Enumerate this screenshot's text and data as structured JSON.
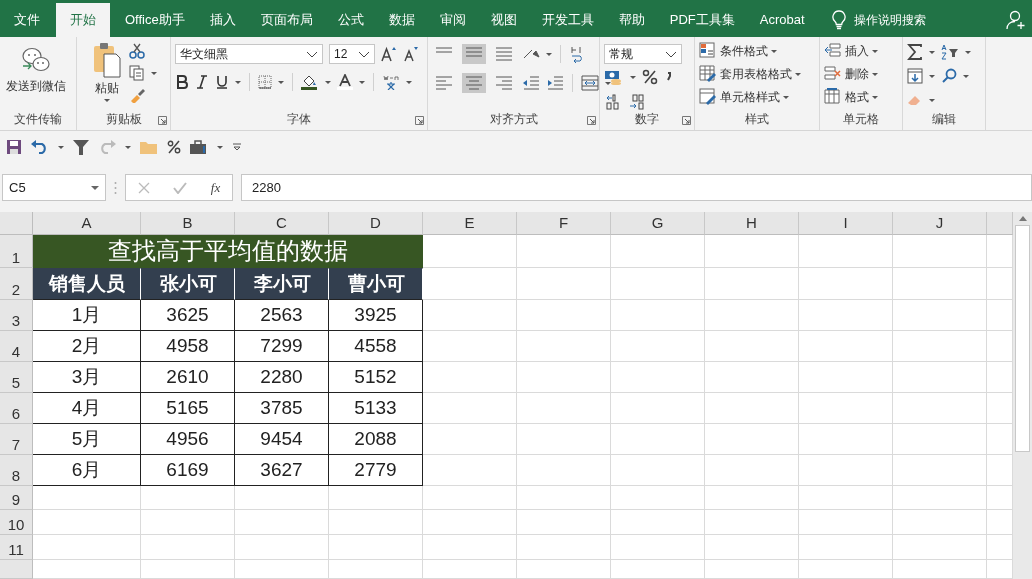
{
  "tabs": [
    {
      "label": "文件",
      "selected": false
    },
    {
      "label": "开始",
      "selected": true
    },
    {
      "label": "Office助手",
      "selected": false
    },
    {
      "label": "插入",
      "selected": false
    },
    {
      "label": "页面布局",
      "selected": false
    },
    {
      "label": "公式",
      "selected": false
    },
    {
      "label": "数据",
      "selected": false
    },
    {
      "label": "审阅",
      "selected": false
    },
    {
      "label": "视图",
      "selected": false
    },
    {
      "label": "开发工具",
      "selected": false
    },
    {
      "label": "帮助",
      "selected": false
    },
    {
      "label": "PDF工具集",
      "selected": false
    },
    {
      "label": "Acrobat",
      "selected": false
    }
  ],
  "tell_me": "操作说明搜索",
  "ribbon_groups": [
    {
      "kind": "wechat",
      "label": "文件传输",
      "button": "发送到微信"
    },
    {
      "kind": "clipboard",
      "label": "剪贴板",
      "button": "粘贴"
    },
    {
      "kind": "font",
      "label": "字体",
      "font_name": "华文细黑",
      "font_size": "12"
    },
    {
      "kind": "align",
      "label": "对齐方式"
    },
    {
      "kind": "number",
      "label": "数字",
      "format": "常规"
    },
    {
      "kind": "styles",
      "label": "样式",
      "buttons": [
        "条件格式",
        "套用表格格式",
        "单元格样式"
      ]
    },
    {
      "kind": "cells",
      "label": "单元格",
      "buttons": [
        "插入",
        "删除",
        "格式"
      ]
    },
    {
      "kind": "editing",
      "label": "编辑"
    }
  ],
  "name_box": "C5",
  "function_button": "fx",
  "formula": "2280",
  "sheet": {
    "columns": [
      "A",
      "B",
      "C",
      "D",
      "E",
      "F",
      "G",
      "H",
      "I",
      "J"
    ],
    "rows": [
      "1",
      "2",
      "3",
      "4",
      "5",
      "6",
      "7",
      "8",
      "9",
      "10",
      "11"
    ],
    "title": "查找高于平均值的数据",
    "header": [
      "销售人员",
      "张小可",
      "李小可",
      "曹小可"
    ],
    "data": [
      [
        "1月",
        "3625",
        "2563",
        "3925"
      ],
      [
        "2月",
        "4958",
        "7299",
        "4558"
      ],
      [
        "3月",
        "2610",
        "2280",
        "5152"
      ],
      [
        "4月",
        "5165",
        "3785",
        "5133"
      ],
      [
        "5月",
        "4956",
        "9454",
        "2088"
      ],
      [
        "6月",
        "6169",
        "3627",
        "2779"
      ]
    ]
  }
}
